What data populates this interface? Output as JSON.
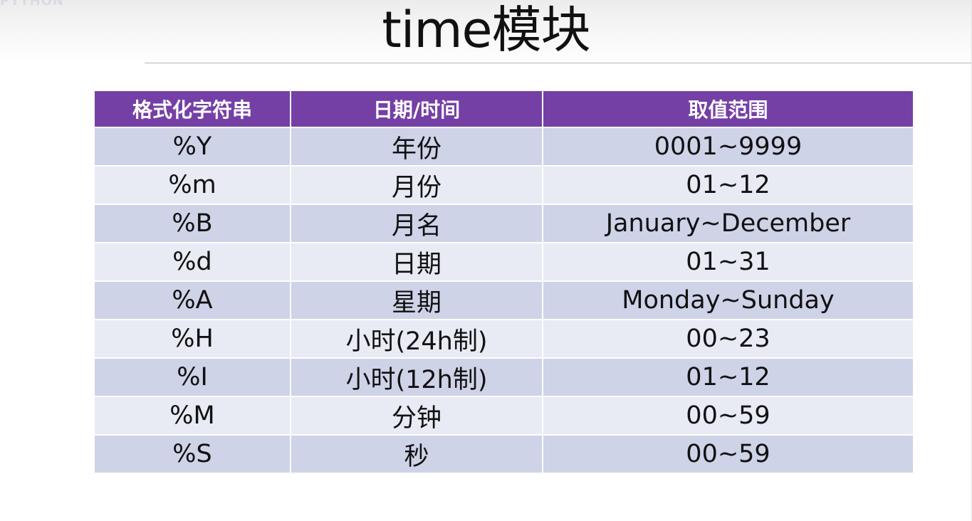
{
  "slide": {
    "corner_mark": "PYTHON",
    "title": "time模块"
  },
  "table": {
    "headers": [
      "格式化字符串",
      "日期/时间",
      "取值范围"
    ],
    "rows": [
      {
        "format": "%Y",
        "meaning": "年份",
        "range": "0001~9999"
      },
      {
        "format": "%m",
        "meaning": "月份",
        "range": "01~12"
      },
      {
        "format": "%B",
        "meaning": "月名",
        "range": "January~December"
      },
      {
        "format": "%d",
        "meaning": "日期",
        "range": "01~31"
      },
      {
        "format": "%A",
        "meaning": "星期",
        "range": "Monday~Sunday"
      },
      {
        "format": "%H",
        "meaning": "小时(24h制)",
        "range": "00~23"
      },
      {
        "format": "%I",
        "meaning": "小时(12h制)",
        "range": "01~12"
      },
      {
        "format": "%M",
        "meaning": "分钟",
        "range": "00~59"
      },
      {
        "format": "%S",
        "meaning": "秒",
        "range": "00~59"
      }
    ]
  },
  "colors": {
    "header_bg": "#7540a5",
    "row_odd_bg": "#cfd3e8",
    "row_even_bg": "#e8eaf4"
  }
}
